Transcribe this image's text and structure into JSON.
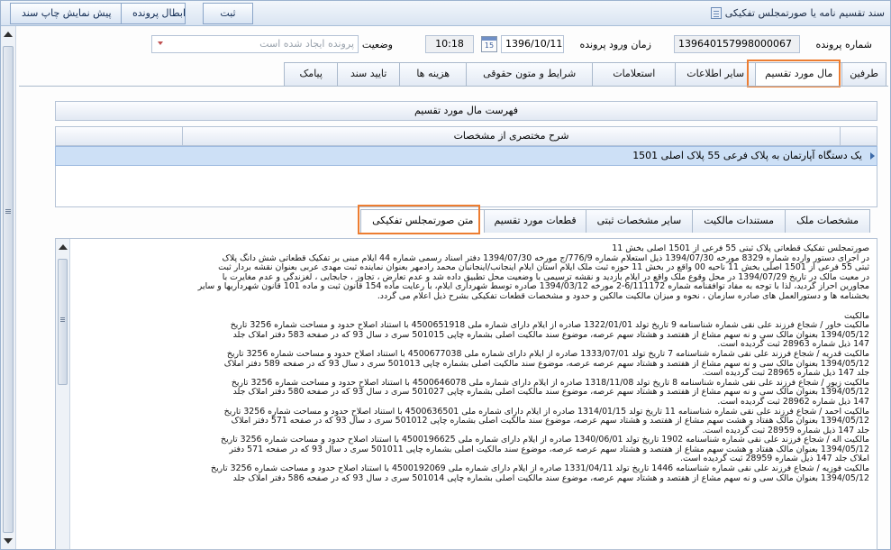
{
  "window": {
    "title": "سند تقسیم نامه یا صورتمجلس تفکیکی"
  },
  "toolbar": {
    "save": "ثبت",
    "cancel_file": "ابطال پرونده",
    "print_preview": "پیش نمایش چاپ سند"
  },
  "form": {
    "file_number_label": "شماره پرونده",
    "file_number": "139640157998000067",
    "entry_time_label": "زمان ورود پرونده",
    "entry_date": "1396/10/11",
    "entry_clock": "10:18",
    "calendar_day": "15",
    "status_label": "وضعیت",
    "status_value": "پرونده ایجاد شده است"
  },
  "tabs": [
    {
      "label": "طرفین"
    },
    {
      "label": "مال مورد تقسیم"
    },
    {
      "label": "سایر اطلاعات"
    },
    {
      "label": "استعلامات"
    },
    {
      "label": "شرایط و متون حقوقی"
    },
    {
      "label": "هزینه ها"
    },
    {
      "label": "تایید سند"
    },
    {
      "label": "پیامک"
    }
  ],
  "grid": {
    "caption": "فهرست مال مورد تقسیم",
    "column": "شرح مختصری از مشخصات",
    "row": "یک دستگاه آپارتمان به پلاک فرعی 55 پلاک اصلی 1501"
  },
  "subtabs": [
    {
      "label": "مشخصات ملک"
    },
    {
      "label": "مستندات مالکیت"
    },
    {
      "label": "سایر مشخصات ثبتی"
    },
    {
      "label": "قطعات مورد تقسیم"
    },
    {
      "label": "متن صورتمجلس تفکیکی"
    }
  ],
  "document": {
    "lines_1": [
      "صورتمجلس  تفکیک قطعاتی پلاک ثبتی 55 فرعی از 1501 اصلی بخش 11",
      "در اجرای دستور وارده شماره 8329 مورخه 1394/07/30 ذیل استعلام شماره 776/9/ج مورخه 1394/07/30 دفتر اسناد رسمی شماره 44 ایلام مبنی بر تفکیک قطعاتی شش دانگ پلاک",
      "ثبتی 55 فرعی از 1501 اصلی بخش 11 ناحیه 00 واقع در بخش 11 حوزه ثبت ملک ایلام استان ایلام اینجانب/اینجانبان محمد رادمهر بعنوان نماینده ثبت مهدی عربی بعنوان نقشه بردار ثبت",
      "در معیت مالک در تاریخ 1394/07/29 در محل وقوع ملک واقع در ایلام بازدید و نقشه ترسیمی با وضعیت محل تطبیق داده شد  و عدم تعارض ، تجاوز ، جابجایی ، لغزندگی و عدم مغایرت با",
      "مجاورین احراز گردید، لذا با توجه به مفاد توافقنامه شماره 6/111172-2 مورخه 1394/03/12 صادره توسط شهرداری ایلام، با رعایت ماده 154 قانون ثبت و ماده 101 قانون شهرداریها و سایر",
      "بخشنامه ها و دستورالعمل های صادره سازمان ، نحوه و میزان مالکیت مالکین و حدود و مشخصات قطعات تفکیکی بشرح ذیل اعلام می گردد."
    ],
    "lines_2": [
      "مالکیت",
      "مالکیت خاور / شجاع فرزند علی نقی شماره شناسنامه 9 تاریخ تولد 1322/01/01 صادره از ایلام دارای شماره ملی 4500651918 با استناد اصلاح حدود و مساحت شماره 3256 تاریخ",
      "1394/05/12  بعنوان مالک سی و نه سهم مشاع از هفتصد و هشتاد سهم عرصه، موضوع سند مالکیت اصلی بشماره چاپی 501015 سری د سال 93 که در صفحه 583 دفتر املاک جلد",
      "147 ذیل شماره 28963 ثبت گردیده است.",
      "مالکیت قدریه / شجاع فرزند علی نقی شماره شناسنامه 7 تاریخ تولد 1333/07/01 صادره از ایلام دارای شماره ملی 4500677038 با استناد اصلاح حدود و مساحت شماره 3256 تاریخ",
      "1394/05/12  بعنوان مالک سی و نه سهم مشاع از هفتصد و هشتاد سهم عرصه عرصه، موضوع سند مالکیت اصلی بشماره چاپی 501013 سری د سال 93 که در صفحه 589 دفتر املاک",
      "جلد 147 ذیل شماره 28965 ثبت گردیده است.",
      "مالکیت زیور / شجاع فرزند علی نقی شماره شناسنامه 8 تاریخ تولد 1318/11/08 صادره از ایلام دارای شماره ملی 4500646078 با استناد اصلاح حدود و مساحت شماره 3256 تاریخ",
      "1394/05/12  بعنوان مالک سی و نه سهم مشاع از هفتصد و هشتاد سهم عرصه، موضوع سند مالکیت اصلی بشماره چاپی 501027 سری د سال 93 که در صفحه 580 دفتر املاک جلد",
      "147 ذیل شماره 28962 ثبت گردیده است.",
      "مالکیت احمد / شجاع فرزند علی نقی شماره شناسنامه 11 تاریخ تولد 1314/01/15 صادره از ایلام دارای شماره ملی 4500636501 با استناد اصلاح حدود و مساحت شماره 3256 تاریخ",
      "1394/05/12  بعنوان مالک هفتاد و هشت سهم مشاع از هفتصد و هشتاد سهم  عرصه، موضوع سند مالکیت اصلی بشماره چاپی 501012 سری د سال 93 که در صفحه 571 دفتر املاک",
      "جلد 147 ذیل شماره 28959 ثبت گردیده است.",
      "مالکیت اله / شجاع فرزند علی نقی شماره شناسنامه 1902 تاریخ تولد 1340/06/01 صادره از ایلام دارای شماره ملی 4500196625 با استناد اصلاح حدود و مساحت شماره 3256 تاریخ",
      "1394/05/12  بعنوان مالک هفتاد و هشت سهم مشاع از هفتصد و هشتاد سهم عرصه عرصه، موضوع سند مالکیت اصلی بشماره چاپی 501011 سری د سال 93 که در صفحه 571 دفتر",
      "املاک جلد 147 ذیل شماره 28959 ثبت گردیده است.",
      "مالکیت فوزیه / شجاع فرزند علی نقی شماره شناسنامه 1446 تاریخ تولد 1331/04/11 صادره از ایلام دارای شماره ملی 4500192069 با استناد اصلاح حدود و مساحت شماره 3256 تاریخ",
      "1394/05/12  بعنوان مالک سی و نه سهم مشاع از هفتصد و هشتاد سهم  عرصه، موضوع سند مالکیت اصلی بشماره چاپی 501014 سری د سال 93 که در صفحه 586 دفتر املاک جلد"
    ]
  }
}
